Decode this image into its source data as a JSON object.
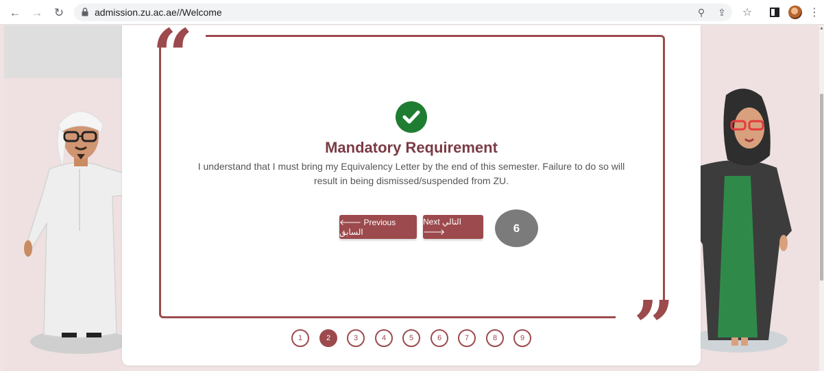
{
  "browser": {
    "url": "admission.zu.ac.ae//Welcome",
    "back_glyph": "←",
    "forward_glyph": "→",
    "reload_glyph": "↻",
    "zoom_glyph": "⚲",
    "share_glyph": "⇪",
    "star_glyph": "☆",
    "menu_glyph": "⋮"
  },
  "content": {
    "title": "Mandatory Requirement",
    "message": "I understand that I must bring my Equivalency Letter by the end of this semester. Failure to do so will result in being dismissed/suspended from ZU.",
    "open_quote": "“",
    "close_quote": "”"
  },
  "buttons": {
    "previous": "🡐 Previous السابق",
    "next": "Next التالي 🡒"
  },
  "step_badge": "6",
  "pager": {
    "pages": [
      "1",
      "2",
      "3",
      "4",
      "5",
      "6",
      "7",
      "8",
      "9"
    ],
    "active_page": "2"
  },
  "colors": {
    "accent": "#9c4a4d",
    "title": "#7a3b44",
    "success": "#1f7d32"
  }
}
